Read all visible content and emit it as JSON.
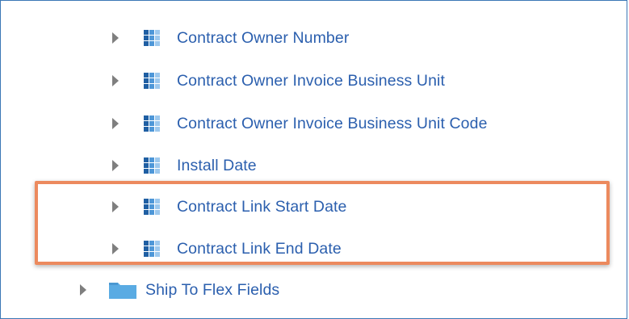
{
  "tree": {
    "attributes": [
      {
        "label": "Contract Owner Number",
        "icon": "grid-icon"
      },
      {
        "label": "Contract Owner Invoice Business Unit",
        "icon": "grid-icon"
      },
      {
        "label": "Contract Owner Invoice Business Unit Code",
        "icon": "grid-icon"
      },
      {
        "label": "Install Date",
        "icon": "grid-icon"
      },
      {
        "label": "Contract Link Start Date",
        "icon": "grid-icon"
      },
      {
        "label": "Contract Link End Date",
        "icon": "grid-icon"
      }
    ],
    "folder": {
      "label": "Ship To Flex Fields",
      "icon": "folder-icon"
    }
  },
  "colors": {
    "label": "#2b5fae",
    "highlight_border": "#ec8a5e",
    "caret": "#7f7f7f",
    "panel_border": "#3b78b6",
    "folder": "#5aabe3"
  }
}
